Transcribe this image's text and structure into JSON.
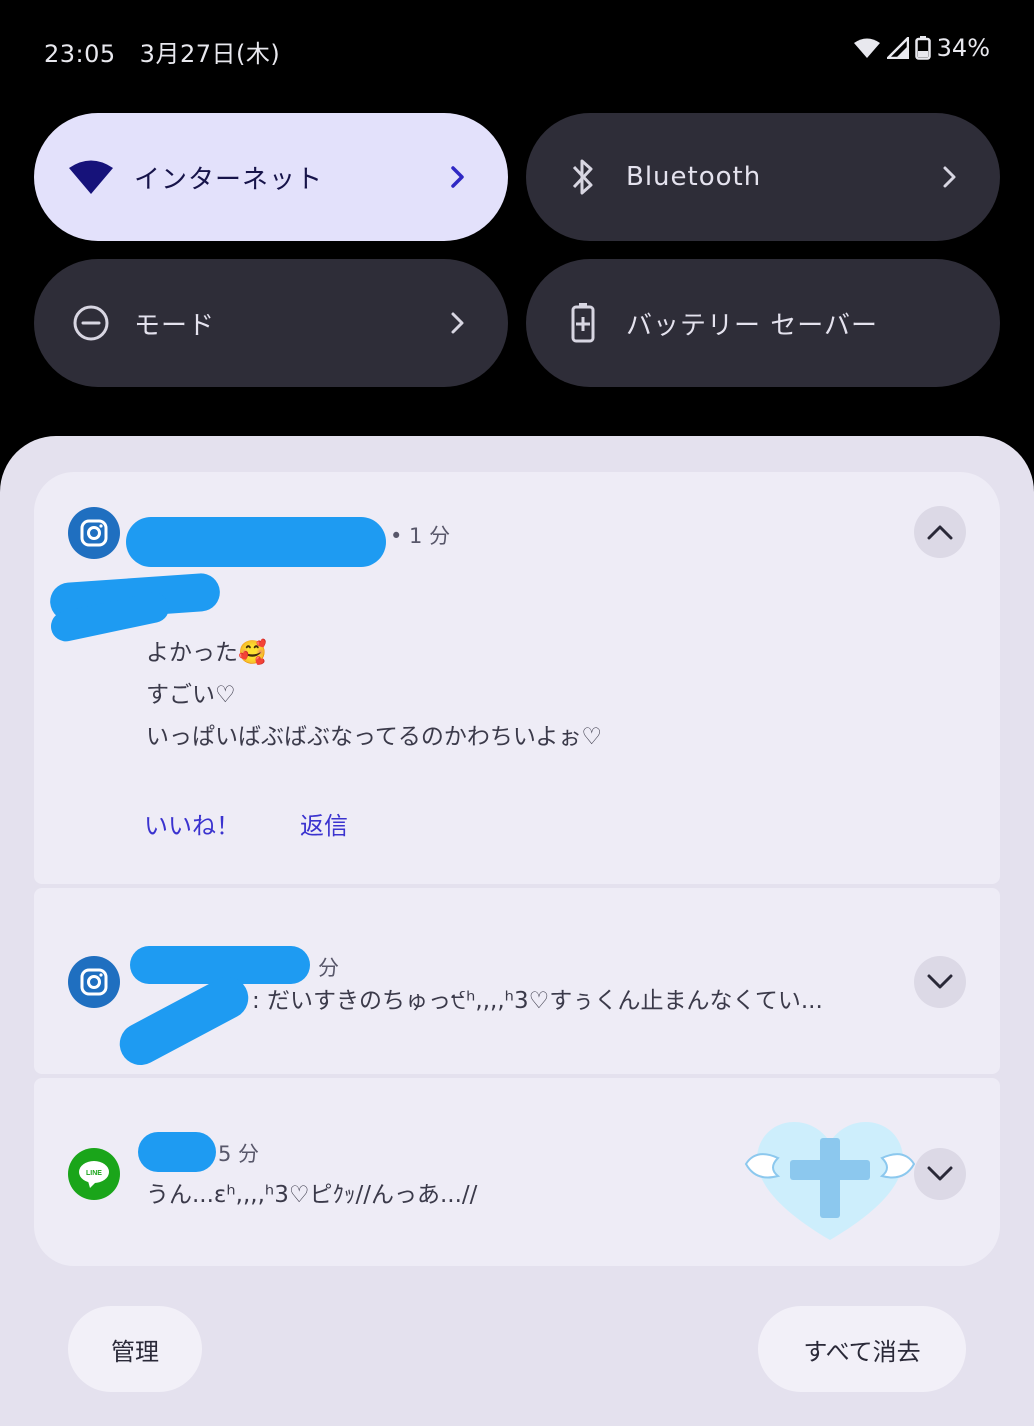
{
  "status_bar": {
    "time": "23:05",
    "date": "3月27日(木)",
    "battery": "34%"
  },
  "tiles": [
    {
      "label": "インターネット",
      "icon": "wifi-icon"
    },
    {
      "label": "Bluetooth",
      "icon": "bluetooth-icon"
    },
    {
      "label": "モード",
      "icon": "do-not-disturb-icon"
    },
    {
      "label": "バッテリー セーバー",
      "icon": "battery-saver-icon"
    }
  ],
  "notifications": [
    {
      "app": "instagram",
      "time": "• 1 分",
      "lines": [
        "よかった🥰",
        "すごい♡",
        "いっぱいばぶばぶなってるのかわちいよぉ♡"
      ],
      "actions": [
        "いいね！",
        "返信"
      ]
    },
    {
      "app": "instagram",
      "time": "分",
      "preview": ": だいすきのちゅっ੯ʰ,,,,ʰ3♡すぅくん止まんなくてい..."
    },
    {
      "app": "line",
      "time": "5 分",
      "preview": "うん...ɛʰ,,,,ʰ3♡ピｸｯ//んっあ...//"
    }
  ],
  "footer": {
    "manage": "管理",
    "clear_all": "すべて消去"
  },
  "colors": {
    "accent": "#3b33cf",
    "active_tile": "#e3e1fb",
    "inactive_tile": "#2e2d38",
    "redaction": "#1e9bf2"
  }
}
